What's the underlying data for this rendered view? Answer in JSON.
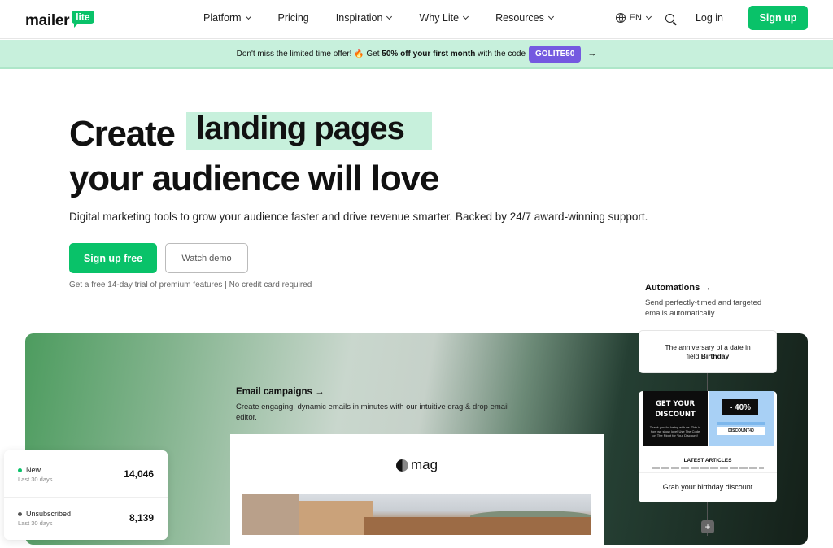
{
  "nav": {
    "logo_word": "mailer",
    "logo_badge": "lite",
    "menu": [
      {
        "label": "Platform",
        "dropdown": true
      },
      {
        "label": "Pricing",
        "dropdown": false
      },
      {
        "label": "Inspiration",
        "dropdown": true
      },
      {
        "label": "Why Lite",
        "dropdown": true
      },
      {
        "label": "Resources",
        "dropdown": true
      }
    ],
    "language": "EN",
    "login": "Log in",
    "signup": "Sign up"
  },
  "promo": {
    "text_before": "Don't miss the limited time offer! ",
    "emoji": "🔥",
    "text_get": " Get ",
    "highlight": "50% off your first month",
    "text_after": " with the code",
    "code": "GOLITE50",
    "arrow": "→"
  },
  "hero": {
    "line1_prefix": "Create",
    "line1_highlight": "landing pages",
    "line2": "your audience will love",
    "subtitle": "Digital marketing tools to grow your audience faster and drive revenue smarter. Backed by 24/7 award-winning support.",
    "primary_cta": "Sign up free",
    "secondary_cta": "Watch demo",
    "trial_note": "Get a free 14-day trial of premium features | No credit card required"
  },
  "automations": {
    "title": "Automations →",
    "desc": "Send perfectly-timed and targeted emails automatically.",
    "trigger_line1": "The anniversary of a date in",
    "trigger_line2_prefix": "field ",
    "trigger_line2_bold": "Birthday",
    "email_title_line1": "GET YOUR",
    "email_title_line2": "DISCOUNT",
    "email_small": "Thank you for being with us. This is how we show love! Use The Code on The Right for Your Discount!",
    "email_badge": "- 40%",
    "email_code": "DISCOUNT40",
    "email_articles": "LATEST ARTICLES",
    "email_action": "Grab your birthday discount",
    "add_step": "+"
  },
  "campaigns": {
    "title": "Email campaigns →",
    "desc": "Create engaging, dynamic emails in minutes with our intuitive drag & drop email editor.",
    "brand": "mag"
  },
  "stats": [
    {
      "label": "New",
      "sub": "Last 30 days",
      "value": "14,046",
      "color": "#09c269"
    },
    {
      "label": "Unsubscribed",
      "sub": "Last 30 days",
      "value": "8,139",
      "color": "#555555"
    }
  ],
  "colors": {
    "brand": "#09c269",
    "promo_bg": "#c7f0dc",
    "code_bg": "#7459e0"
  }
}
